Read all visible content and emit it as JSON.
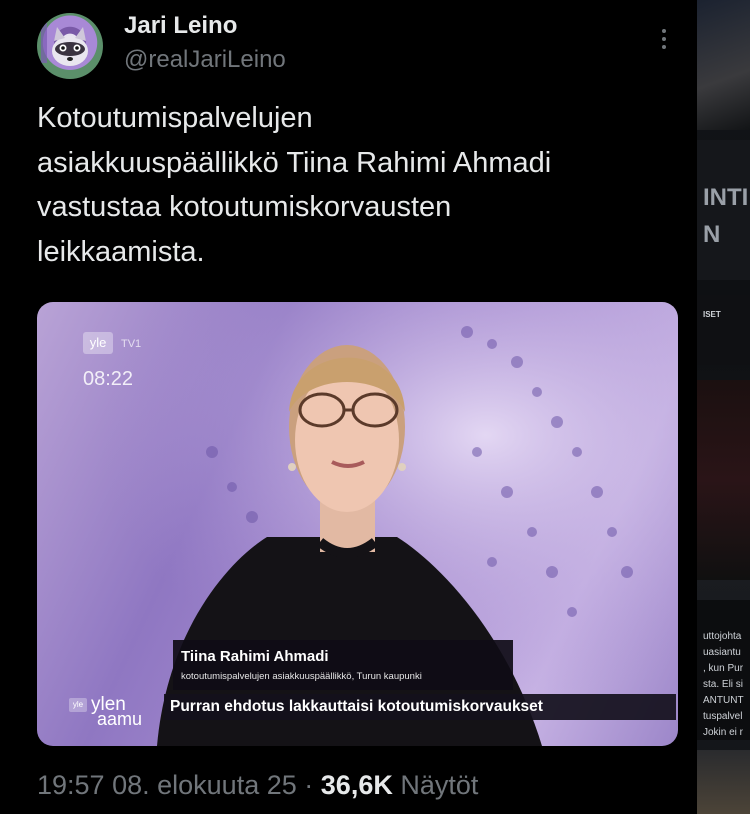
{
  "author": {
    "display_name": "Jari Leino",
    "handle": "@realJariLeino",
    "avatar_icon": "raccoon-avatar-icon"
  },
  "more_icon": "more-horizontal-icon",
  "tweet": {
    "text_lines": [
      "Kotoutumispalvelujen",
      "asiakkuuspäällikkö Tiina Rahimi Ahmadi",
      "vastustaa kotoutumiskorvausten",
      "leikkaamista."
    ]
  },
  "media": {
    "broadcaster_logo": "yle",
    "channel": "TV1",
    "clock": "08:22",
    "lower_third_name": "Tiina Rahimi Ahmadi",
    "lower_third_title": "kotoutumispalvelujen asiakkuuspäällikkö, Turun kaupunki",
    "ticker": "Purran ehdotus lakkauttaisi kotoutumiskorvaukset",
    "show_logo_tag": "yle",
    "show_logo_line1": "ylen",
    "show_logo_line2": "aamu"
  },
  "meta": {
    "time": "19:57",
    "date": "08. elokuuta 25",
    "separator": "·",
    "views_count": "36,6K",
    "views_label": "Näytöt"
  },
  "side_peek": {
    "lines": [
      "INTI",
      "N",
      "ISET",
      "uttojohta",
      "uasiantu",
      ", kun Pur",
      "sta. Eli si",
      "ANTUNT",
      "tuspalvel",
      "Jokin ei r"
    ]
  },
  "colors": {
    "background": "#000000",
    "text_primary": "#e7e9ea",
    "text_secondary": "#71767b"
  }
}
